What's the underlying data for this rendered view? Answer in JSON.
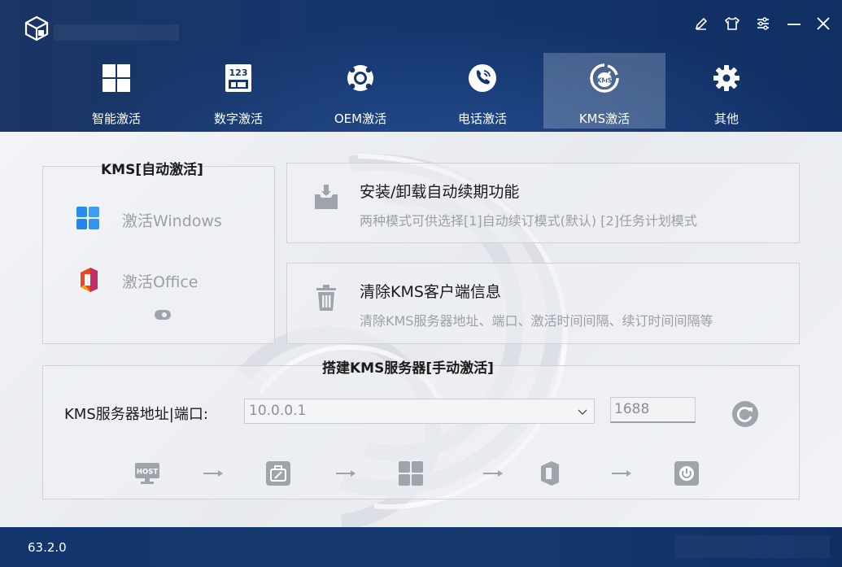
{
  "window": {
    "controls": [
      {
        "name": "edit-icon"
      },
      {
        "name": "skin-icon"
      },
      {
        "name": "settings-sliders-icon"
      },
      {
        "name": "minimize-icon"
      },
      {
        "name": "close-icon"
      }
    ]
  },
  "tabs": [
    {
      "label": "智能激活",
      "icon": "windows-grid-icon",
      "active": false
    },
    {
      "label": "数字激活",
      "icon": "digital-123-icon",
      "active": false
    },
    {
      "label": "OEM激活",
      "icon": "lifebuoy-icon",
      "active": false
    },
    {
      "label": "电话激活",
      "icon": "phone-icon",
      "active": false
    },
    {
      "label": "KMS激活",
      "icon": "kms-gauge-icon",
      "active": true
    },
    {
      "label": "其他",
      "icon": "gear-icon",
      "active": false
    }
  ],
  "auto_panel": {
    "title": "KMS[自动激活]",
    "items": [
      {
        "label": "激活Windows",
        "icon": "windows-logo-icon"
      },
      {
        "label": "激活Office",
        "icon": "office-logo-icon"
      }
    ]
  },
  "cards": [
    {
      "title": "安装/卸载自动续期功能",
      "desc": "两种模式可供选择[1]自动续订模式(默认) [2]任务计划模式",
      "icon": "install-box-icon"
    },
    {
      "title": "清除KMS客户端信息",
      "desc": "清除KMS服务器地址、端口、激活时间间隔、续订时间间隔等",
      "icon": "trash-icon"
    }
  ],
  "server_panel": {
    "title": "搭建KMS服务器[手动激活]",
    "label": "KMS服务器地址|端口:",
    "address": "10.0.0.1",
    "port": "1688"
  },
  "flow_steps": [
    {
      "icon": "host-monitor-icon"
    },
    {
      "icon": "briefcase-icon"
    },
    {
      "icon": "windows-tile-icon"
    },
    {
      "icon": "office-tile-icon"
    },
    {
      "icon": "power-icon"
    }
  ],
  "status": {
    "version": "63.2.0"
  },
  "colors": {
    "accent": "#14366e",
    "text_muted": "#9aa0a8",
    "icon_gray": "#9ea4ac"
  }
}
